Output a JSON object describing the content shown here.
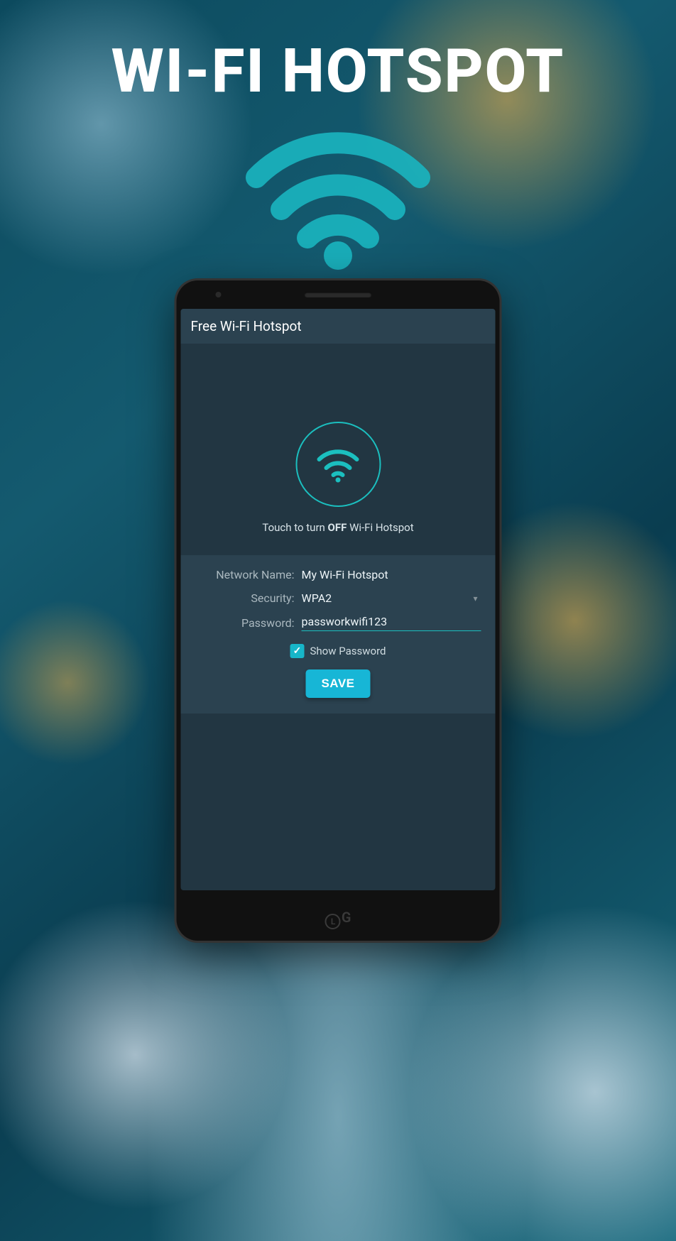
{
  "promo": {
    "title": "WI-FI HOTSPOT"
  },
  "app": {
    "titlebar": "Free Wi-Fi Hotspot",
    "toggle_hint_prefix": "Touch to turn ",
    "toggle_hint_state": "OFF",
    "toggle_hint_suffix": " Wi-Fi Hotspot",
    "form": {
      "network_name_label": "Network Name:",
      "network_name_value": "My Wi-Fi Hotspot",
      "security_label": "Security:",
      "security_value": "WPA2",
      "password_label": "Password:",
      "password_value": "passworkwifi123",
      "show_password_label": "Show Password",
      "show_password_checked": true,
      "save_label": "SAVE"
    }
  },
  "device": {
    "brand": "LG"
  },
  "colors": {
    "accent": "#17b6d6",
    "teal": "#1bbfbf",
    "screen_bg": "#223642",
    "panel_bg": "#2b4250"
  }
}
